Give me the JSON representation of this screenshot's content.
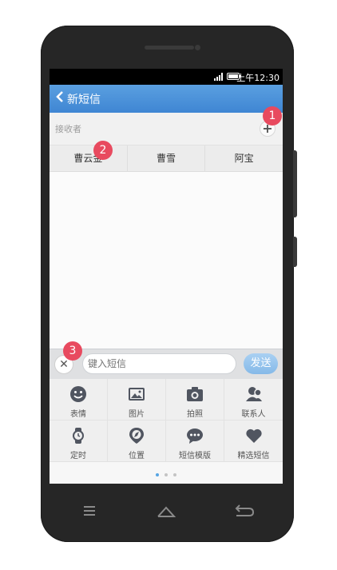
{
  "status": {
    "time": "上午12:30"
  },
  "header": {
    "back_icon": "chevron-left-icon",
    "title": "新短信"
  },
  "recipient": {
    "label": "接收者",
    "add_icon": "plus-icon"
  },
  "contacts": [
    "曹云金",
    "曹雪",
    "阿宝"
  ],
  "compose": {
    "placeholder": "键入短信",
    "send_label": "发送"
  },
  "tools": [
    {
      "label": "表情",
      "icon": "emoji-icon"
    },
    {
      "label": "图片",
      "icon": "image-icon"
    },
    {
      "label": "拍照",
      "icon": "camera-icon"
    },
    {
      "label": "联系人",
      "icon": "contacts-icon"
    },
    {
      "label": "定时",
      "icon": "watch-icon"
    },
    {
      "label": "位置",
      "icon": "compass-icon"
    },
    {
      "label": "短信模版",
      "icon": "chat-icon"
    },
    {
      "label": "精选短信",
      "icon": "heart-icon"
    }
  ],
  "badges": [
    "1",
    "2",
    "3"
  ],
  "colors": {
    "accent": "#4a8fd9",
    "badge": "#e84a5f"
  }
}
